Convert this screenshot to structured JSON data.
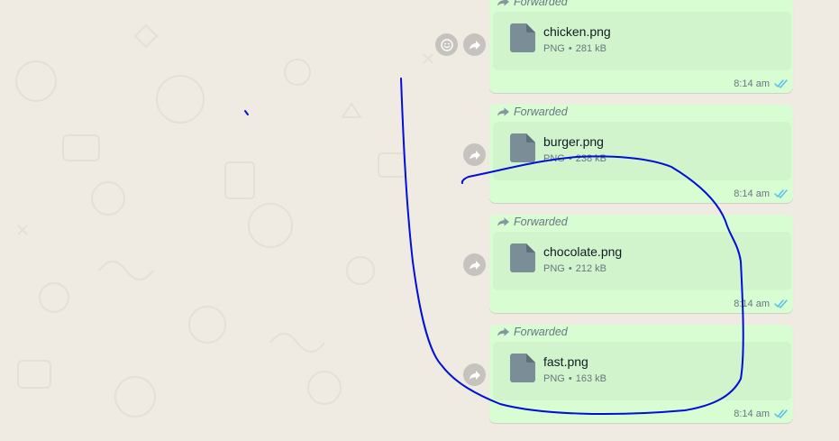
{
  "chat": {
    "messages": [
      {
        "forwarded_label": "Forwarded",
        "file_name": "chicken.png",
        "file_type": "PNG",
        "file_size": "281 kB",
        "time": "8:14 am",
        "status_icon": "double-check-read-icon",
        "has_emoji_button": true
      },
      {
        "forwarded_label": "Forwarded",
        "file_name": "burger.png",
        "file_type": "PNG",
        "file_size": "238 kB",
        "time": "8:14 am",
        "status_icon": "double-check-read-icon",
        "has_emoji_button": false
      },
      {
        "forwarded_label": "Forwarded",
        "file_name": "chocolate.png",
        "file_type": "PNG",
        "file_size": "212 kB",
        "time": "8:14 am",
        "status_icon": "double-check-read-icon",
        "has_emoji_button": false
      },
      {
        "forwarded_label": "Forwarded",
        "file_name": "fast.png",
        "file_type": "PNG",
        "file_size": "163 kB",
        "time": "8:14 am",
        "status_icon": "double-check-read-icon",
        "has_emoji_button": false
      }
    ]
  },
  "colors": {
    "wallpaper": "#efeae2",
    "outgoing_bubble": "#d9fdd3",
    "document_card": "#d1f4cc",
    "read_ticks": "#53bdeb",
    "annotation_ink": "#0010d8"
  }
}
